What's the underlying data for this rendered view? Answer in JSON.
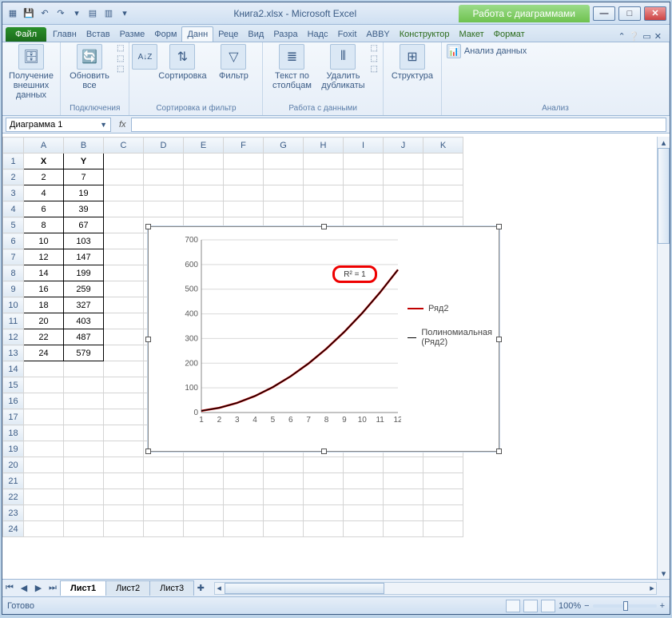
{
  "window": {
    "title": "Книга2.xlsx - Microsoft Excel",
    "context_title": "Работа с диаграммами"
  },
  "qat": {
    "save": "💾",
    "undo": "↶",
    "redo": "↷"
  },
  "tabs": {
    "file": "Файл",
    "items": [
      "Главн",
      "Встав",
      "Разме",
      "Форм",
      "Данн",
      "Реце",
      "Вид",
      "Разра",
      "Надс",
      "Foxit",
      "ABBY"
    ],
    "context_items": [
      "Конструктор",
      "Макет",
      "Формат"
    ],
    "active_index": 4
  },
  "ribbon": {
    "g0": {
      "btn": "Получение внешних данных",
      "label": ""
    },
    "g1": {
      "btn": "Обновить все",
      "label": "Подключения"
    },
    "g2": {
      "sort": "Сортировка",
      "filter": "Фильтр",
      "label": "Сортировка и фильтр"
    },
    "g3": {
      "t2c": "Текст по столбцам",
      "dedup": "Удалить дубликаты",
      "label": "Работа с данными"
    },
    "g4": {
      "btn": "Структура",
      "label": ""
    },
    "g5": {
      "btn": "Анализ данных",
      "label": "Анализ"
    }
  },
  "namebox": "Диаграмма 1",
  "fx_label": "fx",
  "columns": [
    "A",
    "B",
    "C",
    "D",
    "E",
    "F",
    "G",
    "H",
    "I",
    "J",
    "K"
  ],
  "rows": 24,
  "table": {
    "headers": [
      "X",
      "Y"
    ],
    "data": [
      [
        2,
        7
      ],
      [
        4,
        19
      ],
      [
        6,
        39
      ],
      [
        8,
        67
      ],
      [
        10,
        103
      ],
      [
        12,
        147
      ],
      [
        14,
        199
      ],
      [
        16,
        259
      ],
      [
        18,
        327
      ],
      [
        20,
        403
      ],
      [
        22,
        487
      ],
      [
        24,
        579
      ]
    ]
  },
  "chart_data": {
    "type": "line",
    "x": [
      1,
      2,
      3,
      4,
      5,
      6,
      7,
      8,
      9,
      10,
      11,
      12
    ],
    "series": [
      {
        "name": "Ряд2",
        "values": [
          7,
          19,
          39,
          67,
          103,
          147,
          199,
          259,
          327,
          403,
          487,
          579
        ],
        "color": "#c00000"
      },
      {
        "name": "Полиномиальная (Ряд2)",
        "values": [
          7,
          19,
          39,
          67,
          103,
          147,
          199,
          259,
          327,
          403,
          487,
          579
        ],
        "color": "#000000"
      }
    ],
    "ylim": [
      0,
      700
    ],
    "yticks": [
      0,
      100,
      200,
      300,
      400,
      500,
      600,
      700
    ],
    "xticks": [
      1,
      2,
      3,
      4,
      5,
      6,
      7,
      8,
      9,
      10,
      11,
      12
    ],
    "r2_label": "R² = 1"
  },
  "legend": {
    "series": "Ряд2",
    "trend": "Полиномиальная (Ряд2)"
  },
  "sheet_tabs": [
    "Лист1",
    "Лист2",
    "Лист3"
  ],
  "status": {
    "ready": "Готово",
    "zoom": "100%"
  }
}
